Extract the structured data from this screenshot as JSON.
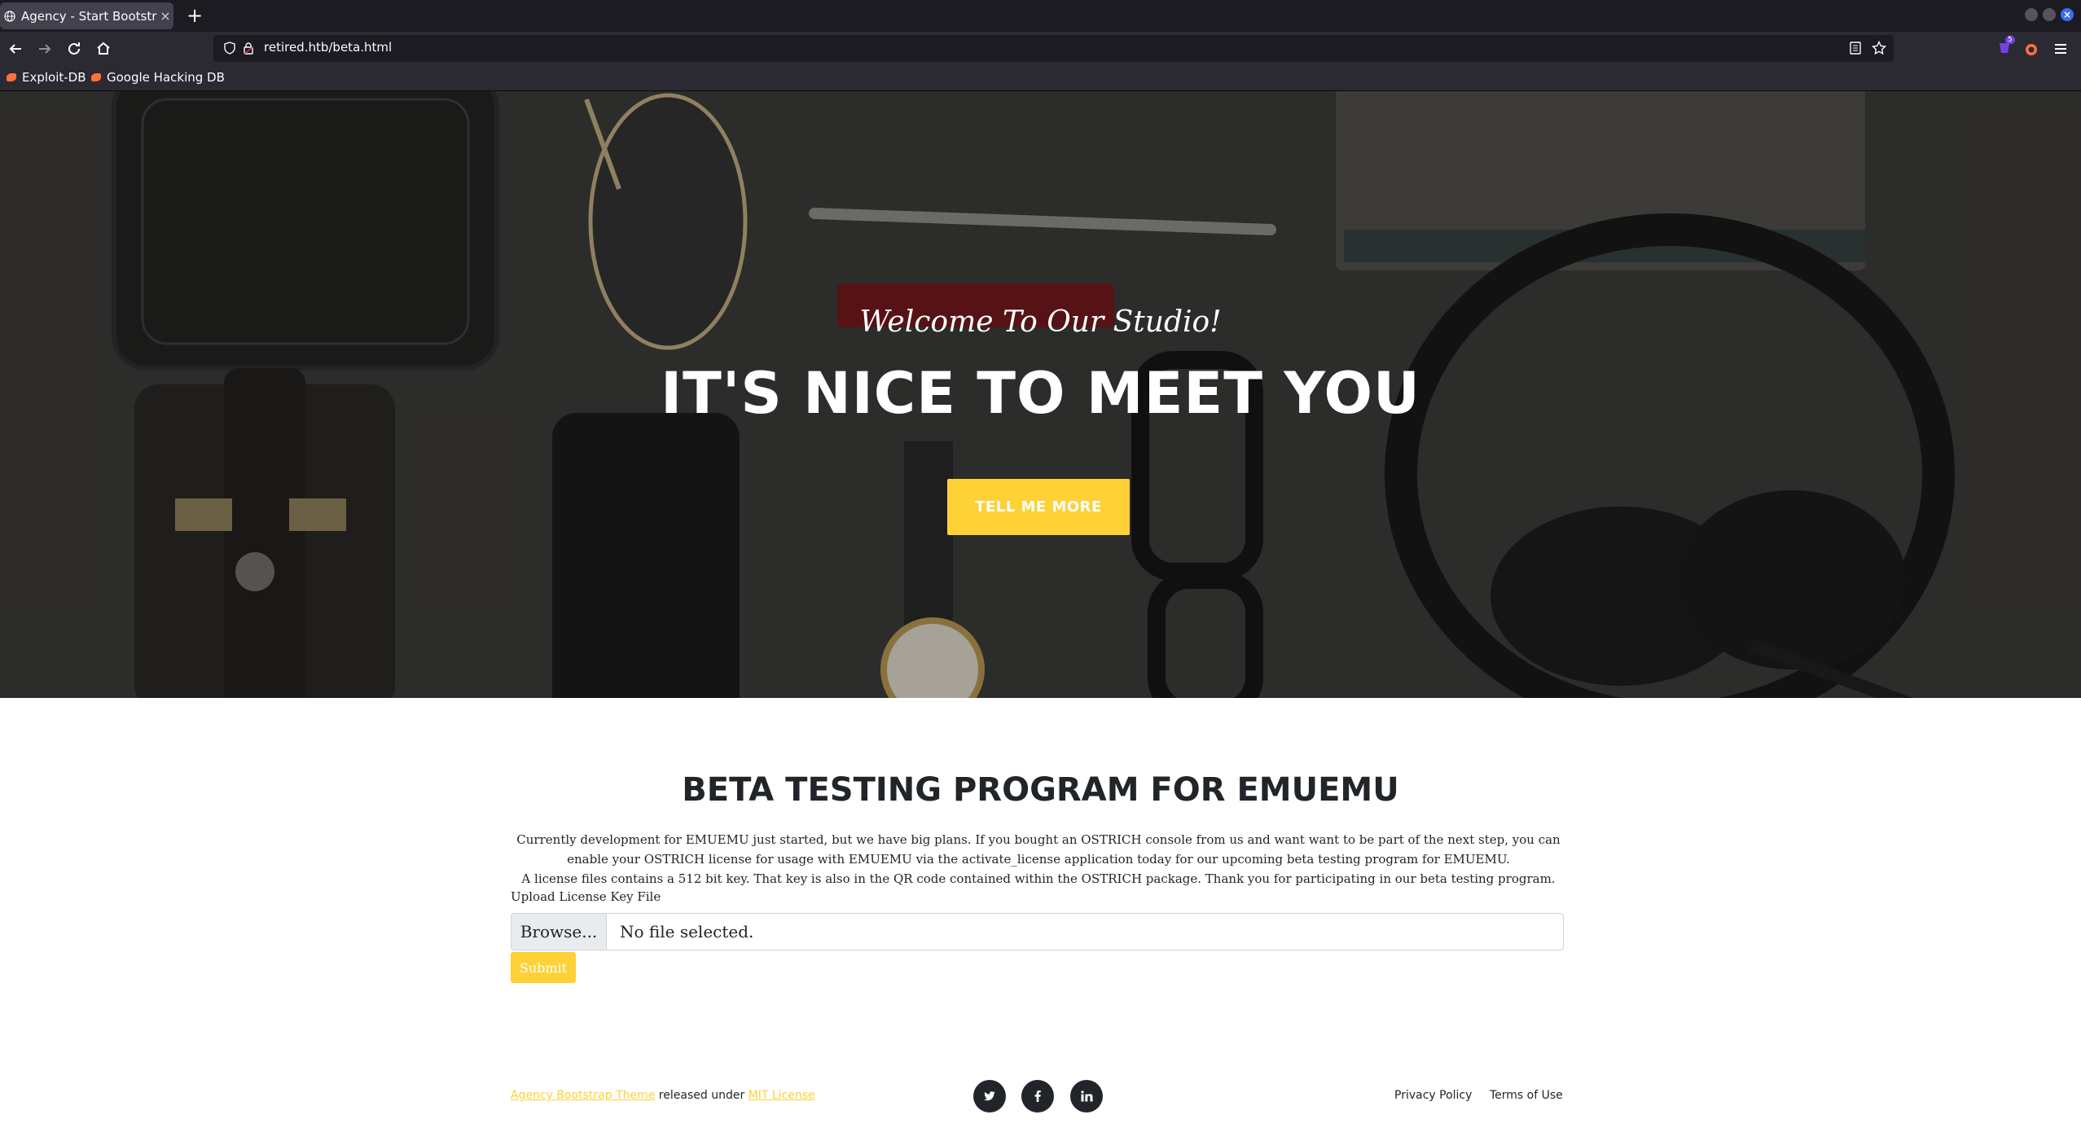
{
  "browser": {
    "tab_title": "Agency - Start Bootstrap",
    "tab_close": "×",
    "new_tab": "+",
    "url": "retired.htb/beta.html",
    "bookmarks": [
      "Exploit-DB",
      "Google Hacking DB"
    ],
    "extension_badge": "5"
  },
  "hero": {
    "subheading": "Welcome To Our Studio!",
    "heading": "IT'S NICE TO MEET YOU",
    "button": "TELL ME MORE"
  },
  "beta": {
    "title": "BETA TESTING PROGRAM FOR EMUEMU",
    "description_lines": [
      "Currently development for EMUEMU just started, but we have big plans. If you bought an OSTRICH console from us and want want to be part of the next step, you can",
      "enable your OSTRICH license for usage with EMUEMU via the activate_license application today for our upcoming beta testing program for EMUEMU.",
      "A license files contains a 512 bit key. That key is also in the QR code contained within the OSTRICH package. Thank you for participating in our beta testing program."
    ],
    "upload_label": "Upload License Key File",
    "browse_button": "Browse...",
    "file_status": "No file selected.",
    "submit": "Submit"
  },
  "footer": {
    "theme_link": "Agency Bootstrap Theme",
    "released_text": " released under ",
    "license_link": "MIT License",
    "privacy": "Privacy Policy",
    "terms": "Terms of Use",
    "social_icons": [
      "twitter-icon",
      "facebook-icon",
      "linkedin-icon"
    ]
  },
  "colors": {
    "accent": "#fed136",
    "dark": "#212529",
    "chrome_dark": "#1c1b22",
    "chrome": "#2b2a33"
  }
}
